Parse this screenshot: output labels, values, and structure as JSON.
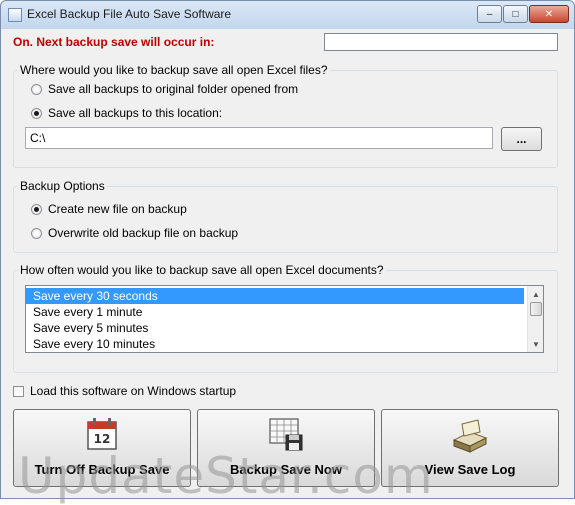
{
  "window": {
    "title": "Excel Backup File Auto Save Software",
    "controls": {
      "minimize": "–",
      "maximize": "□",
      "close": "✕"
    }
  },
  "status": {
    "label": "On. Next backup save will occur in:",
    "value": ""
  },
  "location_group": {
    "legend": "Where would you like to backup save all open Excel files?",
    "options": [
      {
        "label": "Save all backups to original folder opened from",
        "selected": false
      },
      {
        "label": "Save all backups to this location:",
        "selected": true
      }
    ],
    "path_value": "C:\\",
    "browse_label": "..."
  },
  "backup_options": {
    "legend": "Backup Options",
    "options": [
      {
        "label": "Create new file on backup",
        "selected": true
      },
      {
        "label": "Overwrite old backup file on backup",
        "selected": false
      }
    ]
  },
  "frequency_group": {
    "legend": "How often would you like to backup save all open Excel documents?",
    "items": [
      "Save every 30 seconds",
      "Save every 1 minute",
      "Save every 5 minutes",
      "Save every 10 minutes"
    ],
    "selected_index": 0
  },
  "startup": {
    "label": "Load this software on Windows startup",
    "checked": false
  },
  "buttons": {
    "turn_off": "Turn Off Backup Save",
    "backup_now": "Backup Save Now",
    "view_log": "View Save Log"
  },
  "watermark": "UpdateStar.com",
  "colors": {
    "status_red": "#c00000",
    "selection": "#3399ff"
  }
}
